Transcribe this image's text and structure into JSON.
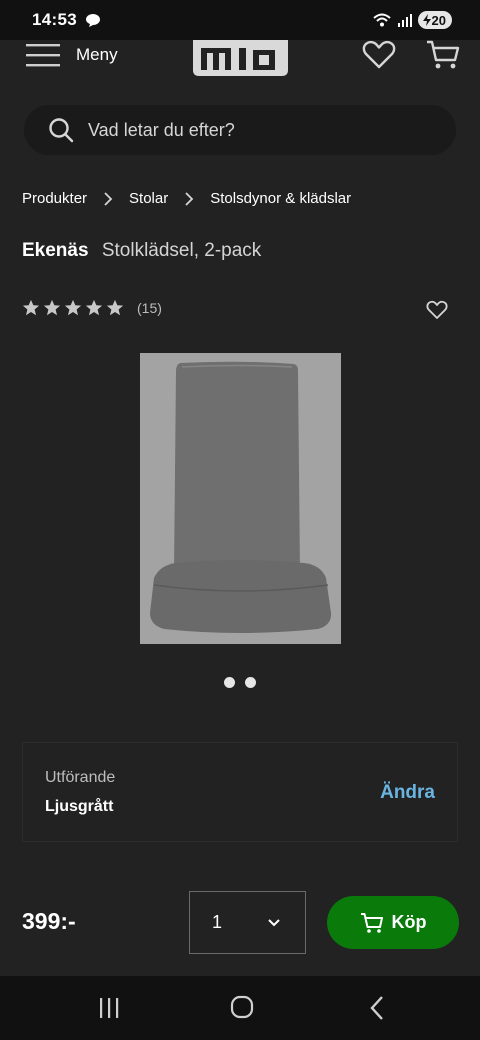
{
  "status_bar": {
    "time": "14:53",
    "battery": "20",
    "icons": [
      "chat-bubble-icon",
      "wifi-icon",
      "signal-icon",
      "battery-icon"
    ]
  },
  "header": {
    "menu_label": "Meny",
    "logo_text": "mio",
    "icons": [
      "hamburger-icon",
      "heart-icon",
      "cart-icon"
    ]
  },
  "search": {
    "placeholder": "Vad letar du efter?"
  },
  "breadcrumb": {
    "items": [
      "Produkter",
      "Stolar",
      "Stolsdynor & klädslar"
    ]
  },
  "product": {
    "brand": "Ekenäs",
    "description": "Stolklädsel, 2-pack",
    "rating_count": "(15)",
    "stars": 5,
    "image_count": 2,
    "active_image": 0
  },
  "variant": {
    "label": "Utförande",
    "value": "Ljusgrått",
    "change_label": "Ändra"
  },
  "purchase": {
    "price": "399:-",
    "quantity": "1",
    "buy_label": "Köp"
  },
  "colors": {
    "background": "#222222",
    "buy_green": "#0a7a0a",
    "link_blue": "#6ab4e2"
  }
}
